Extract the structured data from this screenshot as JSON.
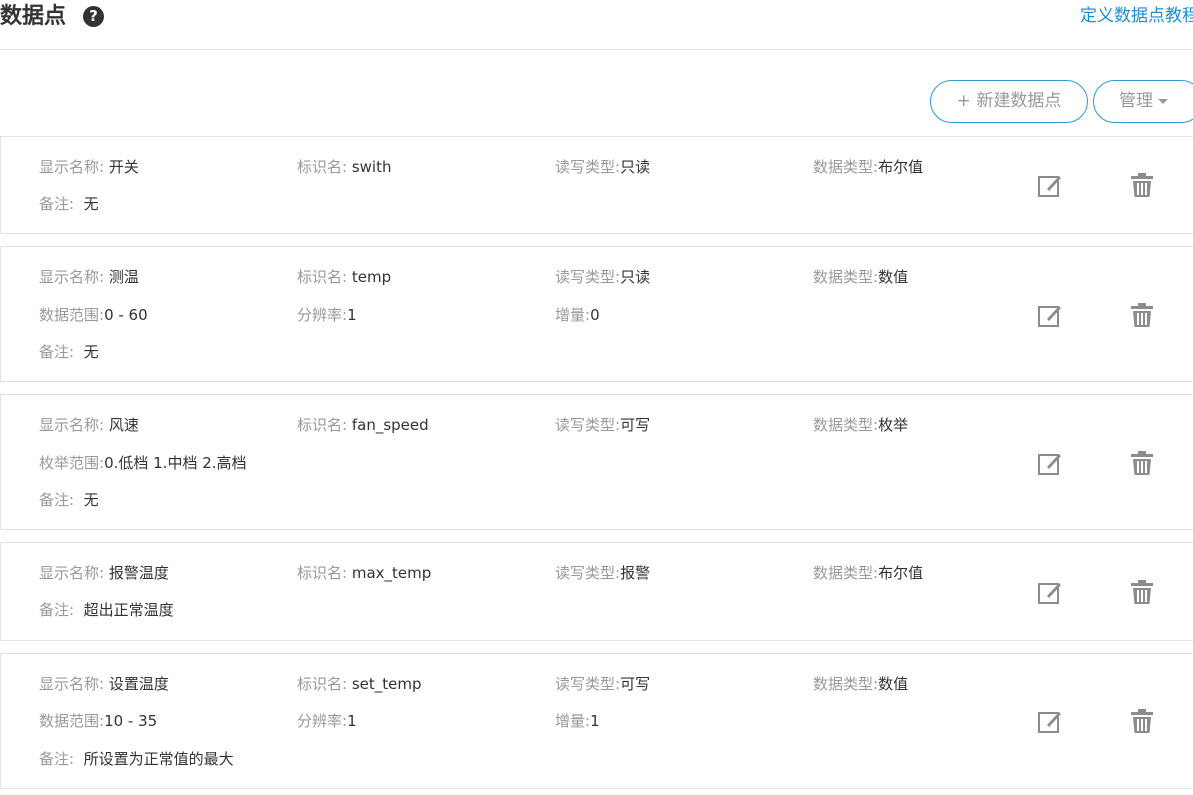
{
  "header": {
    "title": "数据点",
    "help_icon": "question-circle-icon",
    "tutorial_link": "定义数据点教程"
  },
  "toolbar": {
    "new_label": "+ 新建数据点",
    "manage_label": "管理"
  },
  "colors": {
    "accent": "#2b9bd4",
    "link": "#1a8fd6",
    "label": "#999999",
    "value": "#333333",
    "icon": "#8c8c8c"
  },
  "datapoints": [
    {
      "display_name_label": "显示名称:",
      "display_name": "开关",
      "identifier_label": "标识名:",
      "identifier": "swith",
      "rw_label": "读写类型:",
      "rw": "只读",
      "dtype_label": "数据类型:",
      "dtype": "布尔值",
      "remark_label": "备注:",
      "remark": "无"
    },
    {
      "display_name_label": "显示名称:",
      "display_name": "测温",
      "identifier_label": "标识名:",
      "identifier": "temp",
      "rw_label": "读写类型:",
      "rw": "只读",
      "dtype_label": "数据类型:",
      "dtype": "数值",
      "range_label": "数据范围:",
      "range": "0 - 60",
      "resolution_label": "分辨率:",
      "resolution": "1",
      "increment_label": "增量:",
      "increment": "0",
      "remark_label": "备注:",
      "remark": "无"
    },
    {
      "display_name_label": "显示名称:",
      "display_name": "风速",
      "identifier_label": "标识名:",
      "identifier": "fan_speed",
      "rw_label": "读写类型:",
      "rw": "可写",
      "dtype_label": "数据类型:",
      "dtype": "枚举",
      "enum_label": "枚举范围:",
      "enum": "0.低档 1.中档 2.高档",
      "remark_label": "备注:",
      "remark": "无"
    },
    {
      "display_name_label": "显示名称:",
      "display_name": "报警温度",
      "identifier_label": "标识名:",
      "identifier": "max_temp",
      "rw_label": "读写类型:",
      "rw": "报警",
      "dtype_label": "数据类型:",
      "dtype": "布尔值",
      "remark_label": "备注:",
      "remark": "超出正常温度"
    },
    {
      "display_name_label": "显示名称:",
      "display_name": "设置温度",
      "identifier_label": "标识名:",
      "identifier": "set_temp",
      "rw_label": "读写类型:",
      "rw": "可写",
      "dtype_label": "数据类型:",
      "dtype": "数值",
      "range_label": "数据范围:",
      "range": "10 - 35",
      "resolution_label": "分辨率:",
      "resolution": "1",
      "increment_label": "增量:",
      "increment": "1",
      "remark_label": "备注:",
      "remark": "所设置为正常值的最大"
    }
  ]
}
